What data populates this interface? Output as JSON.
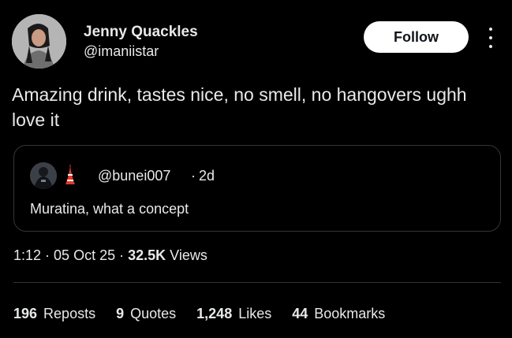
{
  "author": {
    "name": "Jenny Quackles",
    "handle": "@imaniistar"
  },
  "follow_label": "Follow",
  "tweet_text": "Amazing drink, tastes nice, no smell, no hangovers ughh love it",
  "quote": {
    "handle": "@bunei007",
    "separator": "·",
    "time": "2d",
    "text": "Muratina, what a concept",
    "flag_icon": "tokyo-tower-emoji"
  },
  "meta": {
    "time": "1:12",
    "sep1": "·",
    "date": "05 Oct 25",
    "sep2": "·",
    "views_count": "32.5K",
    "views_label": "Views"
  },
  "stats": {
    "reposts_count": "196",
    "reposts_label": "Reposts",
    "quotes_count": "9",
    "quotes_label": "Quotes",
    "likes_count": "1,248",
    "likes_label": "Likes",
    "bookmarks_count": "44",
    "bookmarks_label": "Bookmarks"
  },
  "colors": {
    "background": "#000000",
    "text": "#e7e9ea",
    "border": "#333639",
    "follow_bg": "#ffffff"
  }
}
